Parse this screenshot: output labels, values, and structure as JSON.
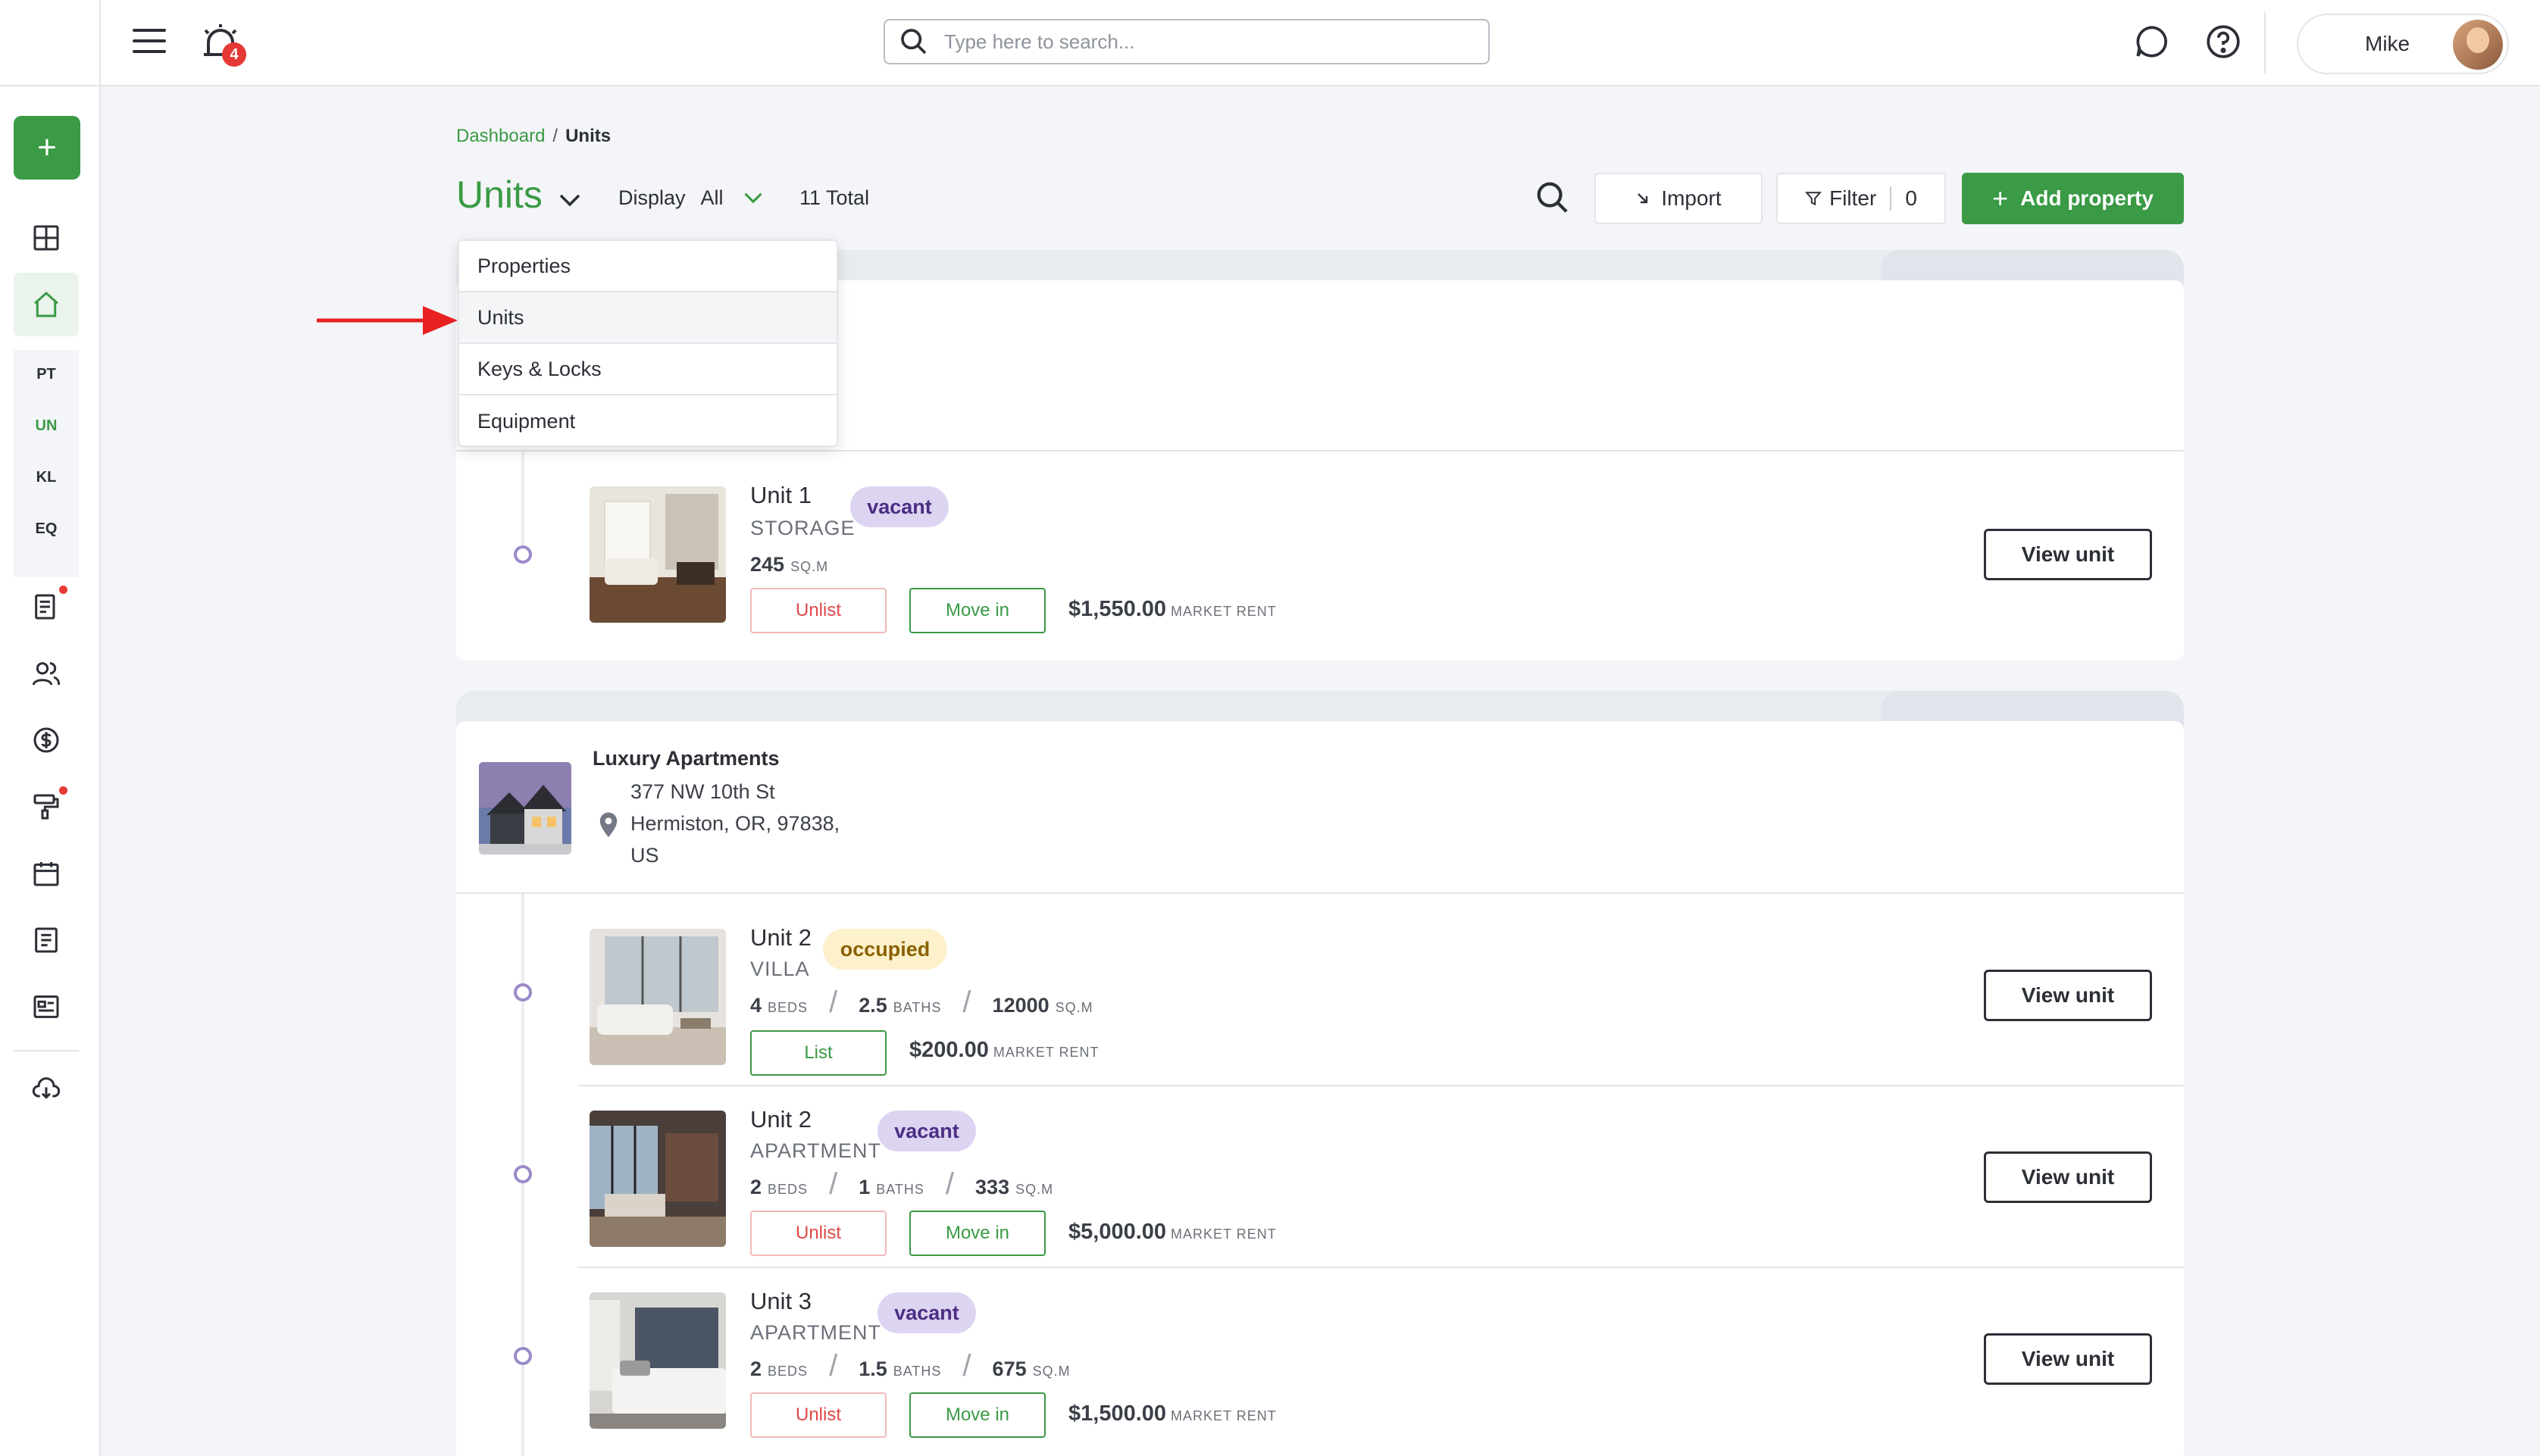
{
  "header": {
    "notification_count": "4",
    "search_placeholder": "Type here to search...",
    "user_name": "Mike"
  },
  "sidebar": {
    "add_label": "+",
    "sub_items": [
      "PT",
      "UN",
      "KL",
      "EQ"
    ],
    "active_sub": "UN"
  },
  "breadcrumb": {
    "root": "Dashboard",
    "separator": "/",
    "current": "Units"
  },
  "toolbar": {
    "title": "Units",
    "display_label": "Display",
    "display_value": "All",
    "total": "11 Total",
    "import_label": "Import",
    "filter_label": "Filter",
    "filter_count": "0",
    "add_label": "Add property"
  },
  "dropdown": {
    "items": [
      "Properties",
      "Units",
      "Keys & Locks",
      "Equipment"
    ],
    "selected": "Units"
  },
  "property_1": {
    "units": [
      {
        "name": "Unit 1",
        "type": "STORAGE",
        "status": "vacant",
        "sqm": "245",
        "sqm_unit": "SQ.M",
        "action_1": "Unlist",
        "action_2": "Move in",
        "rent": "$1,550.00",
        "rent_label": "MARKET RENT",
        "view_label": "View unit"
      }
    ]
  },
  "property_2": {
    "name": "Luxury Apartments",
    "address_line1": "377 NW 10th St",
    "address_line2": "Hermiston, OR, 97838,",
    "address_line3": "US",
    "units": [
      {
        "name": "Unit 2",
        "type": "VILLA",
        "status": "occupied",
        "beds": "4",
        "beds_label": "BEDS",
        "baths": "2.5",
        "baths_label": "BATHS",
        "sqm": "12000",
        "sqm_unit": "SQ.M",
        "action_1": "List",
        "rent": "$200.00",
        "rent_label": "MARKET RENT",
        "view_label": "View unit"
      },
      {
        "name": "Unit 2",
        "type": "APARTMENT",
        "status": "vacant",
        "beds": "2",
        "beds_label": "BEDS",
        "baths": "1",
        "baths_label": "BATHS",
        "sqm": "333",
        "sqm_unit": "SQ.M",
        "action_1": "Unlist",
        "action_2": "Move in",
        "rent": "$5,000.00",
        "rent_label": "MARKET RENT",
        "view_label": "View unit"
      },
      {
        "name": "Unit 3",
        "type": "APARTMENT",
        "status": "vacant",
        "beds": "2",
        "beds_label": "BEDS",
        "baths": "1.5",
        "baths_label": "BATHS",
        "sqm": "675",
        "sqm_unit": "SQ.M",
        "action_1": "Unlist",
        "action_2": "Move in",
        "rent": "$1,500.00",
        "rent_label": "MARKET RENT",
        "view_label": "View unit"
      }
    ]
  },
  "colors": {
    "accent_green": "#3a9a45",
    "badge_red": "#e53935",
    "vacant_bg": "#ddd4f2",
    "occupied_bg": "#fdf1cc"
  }
}
